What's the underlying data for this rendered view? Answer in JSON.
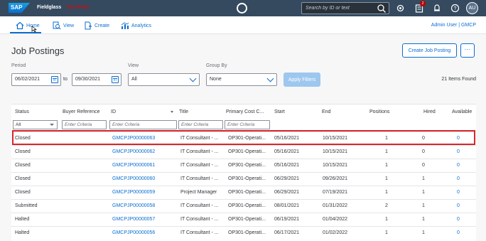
{
  "shell": {
    "logo": "SAP",
    "brand": "Fieldglass",
    "brand_env": "Test Mode",
    "search_placeholder": "Search by ID or text",
    "notification_badge": "2",
    "avatar_initials": "AU"
  },
  "nav": {
    "items": [
      {
        "label": "Home"
      },
      {
        "label": "View"
      },
      {
        "label": "Create"
      },
      {
        "label": "Analytics"
      }
    ],
    "user": "Admin User | GMCP"
  },
  "page": {
    "title": "Job Postings",
    "create_button": "Create Job Posting",
    "more_button": "···"
  },
  "filters": {
    "period_label": "Period",
    "period_from": "06/02/2021",
    "to_label": "to",
    "period_to": "09/30/2021",
    "view_label": "View",
    "view_value": "All",
    "group_label": "Group By",
    "group_value": "None",
    "apply_label": "Apply Filters",
    "items_found": "21 Items Found"
  },
  "table": {
    "headers": {
      "status": "Status",
      "buyer_ref": "Buyer Reference",
      "id": "ID",
      "title": "Title",
      "cost": "Primary Cost C...",
      "start": "Start",
      "end": "End",
      "positions": "Positions",
      "hired": "Hired",
      "available": "Available"
    },
    "filter_row": {
      "status": "All",
      "buyer_ref": "Enter Criteria",
      "id": "Enter Criteria",
      "title": "Enter Criteria",
      "cost": "Enter Criteria"
    },
    "rows": [
      {
        "status": "Closed",
        "id": "GMCPJP00000063",
        "title": "IT Consultant - ...",
        "cost": "OP301-Operati...",
        "start": "05/16/2021",
        "end": "10/15/2021",
        "positions": "1",
        "hired": "0",
        "available": "0"
      },
      {
        "status": "Closed",
        "id": "GMCPJP00000062",
        "title": "IT Consultant - ...",
        "cost": "OP301-Operati...",
        "start": "05/16/2021",
        "end": "10/15/2021",
        "positions": "1",
        "hired": "0",
        "available": "0"
      },
      {
        "status": "Closed",
        "id": "GMCPJP00000061",
        "title": "IT Consultant - ...",
        "cost": "OP301-Operati...",
        "start": "05/16/2021",
        "end": "10/15/2021",
        "positions": "1",
        "hired": "0",
        "available": "0"
      },
      {
        "status": "Closed",
        "id": "GMCPJP00000060",
        "title": "IT Consultant - ...",
        "cost": "OP301-Operati...",
        "start": "06/29/2021",
        "end": "09/26/2021",
        "positions": "1",
        "hired": "1",
        "available": "0"
      },
      {
        "status": "Closed",
        "id": "GMCPJP00000059",
        "title": "Project Manager",
        "cost": "OP301-Operati...",
        "start": "06/29/2021",
        "end": "07/19/2021",
        "positions": "1",
        "hired": "1",
        "available": "0"
      },
      {
        "status": "Submitted",
        "id": "GMCPJP00000058",
        "title": "IT Consultant - ...",
        "cost": "OP301-Operati...",
        "start": "08/01/2021",
        "end": "01/31/2022",
        "positions": "2",
        "hired": "1",
        "available": "0"
      },
      {
        "status": "Halted",
        "id": "GMCPJP00000057",
        "title": "IT Consultant - ...",
        "cost": "OP301-Operati...",
        "start": "06/19/2021",
        "end": "01/04/2022",
        "positions": "1",
        "hired": "1",
        "available": "0"
      },
      {
        "status": "Halted",
        "id": "GMCPJP00000056",
        "title": "IT Consultant - ...",
        "cost": "OP301-Operati...",
        "start": "06/17/2021",
        "end": "01/02/2022",
        "positions": "1",
        "hired": "1",
        "available": "0"
      }
    ]
  }
}
